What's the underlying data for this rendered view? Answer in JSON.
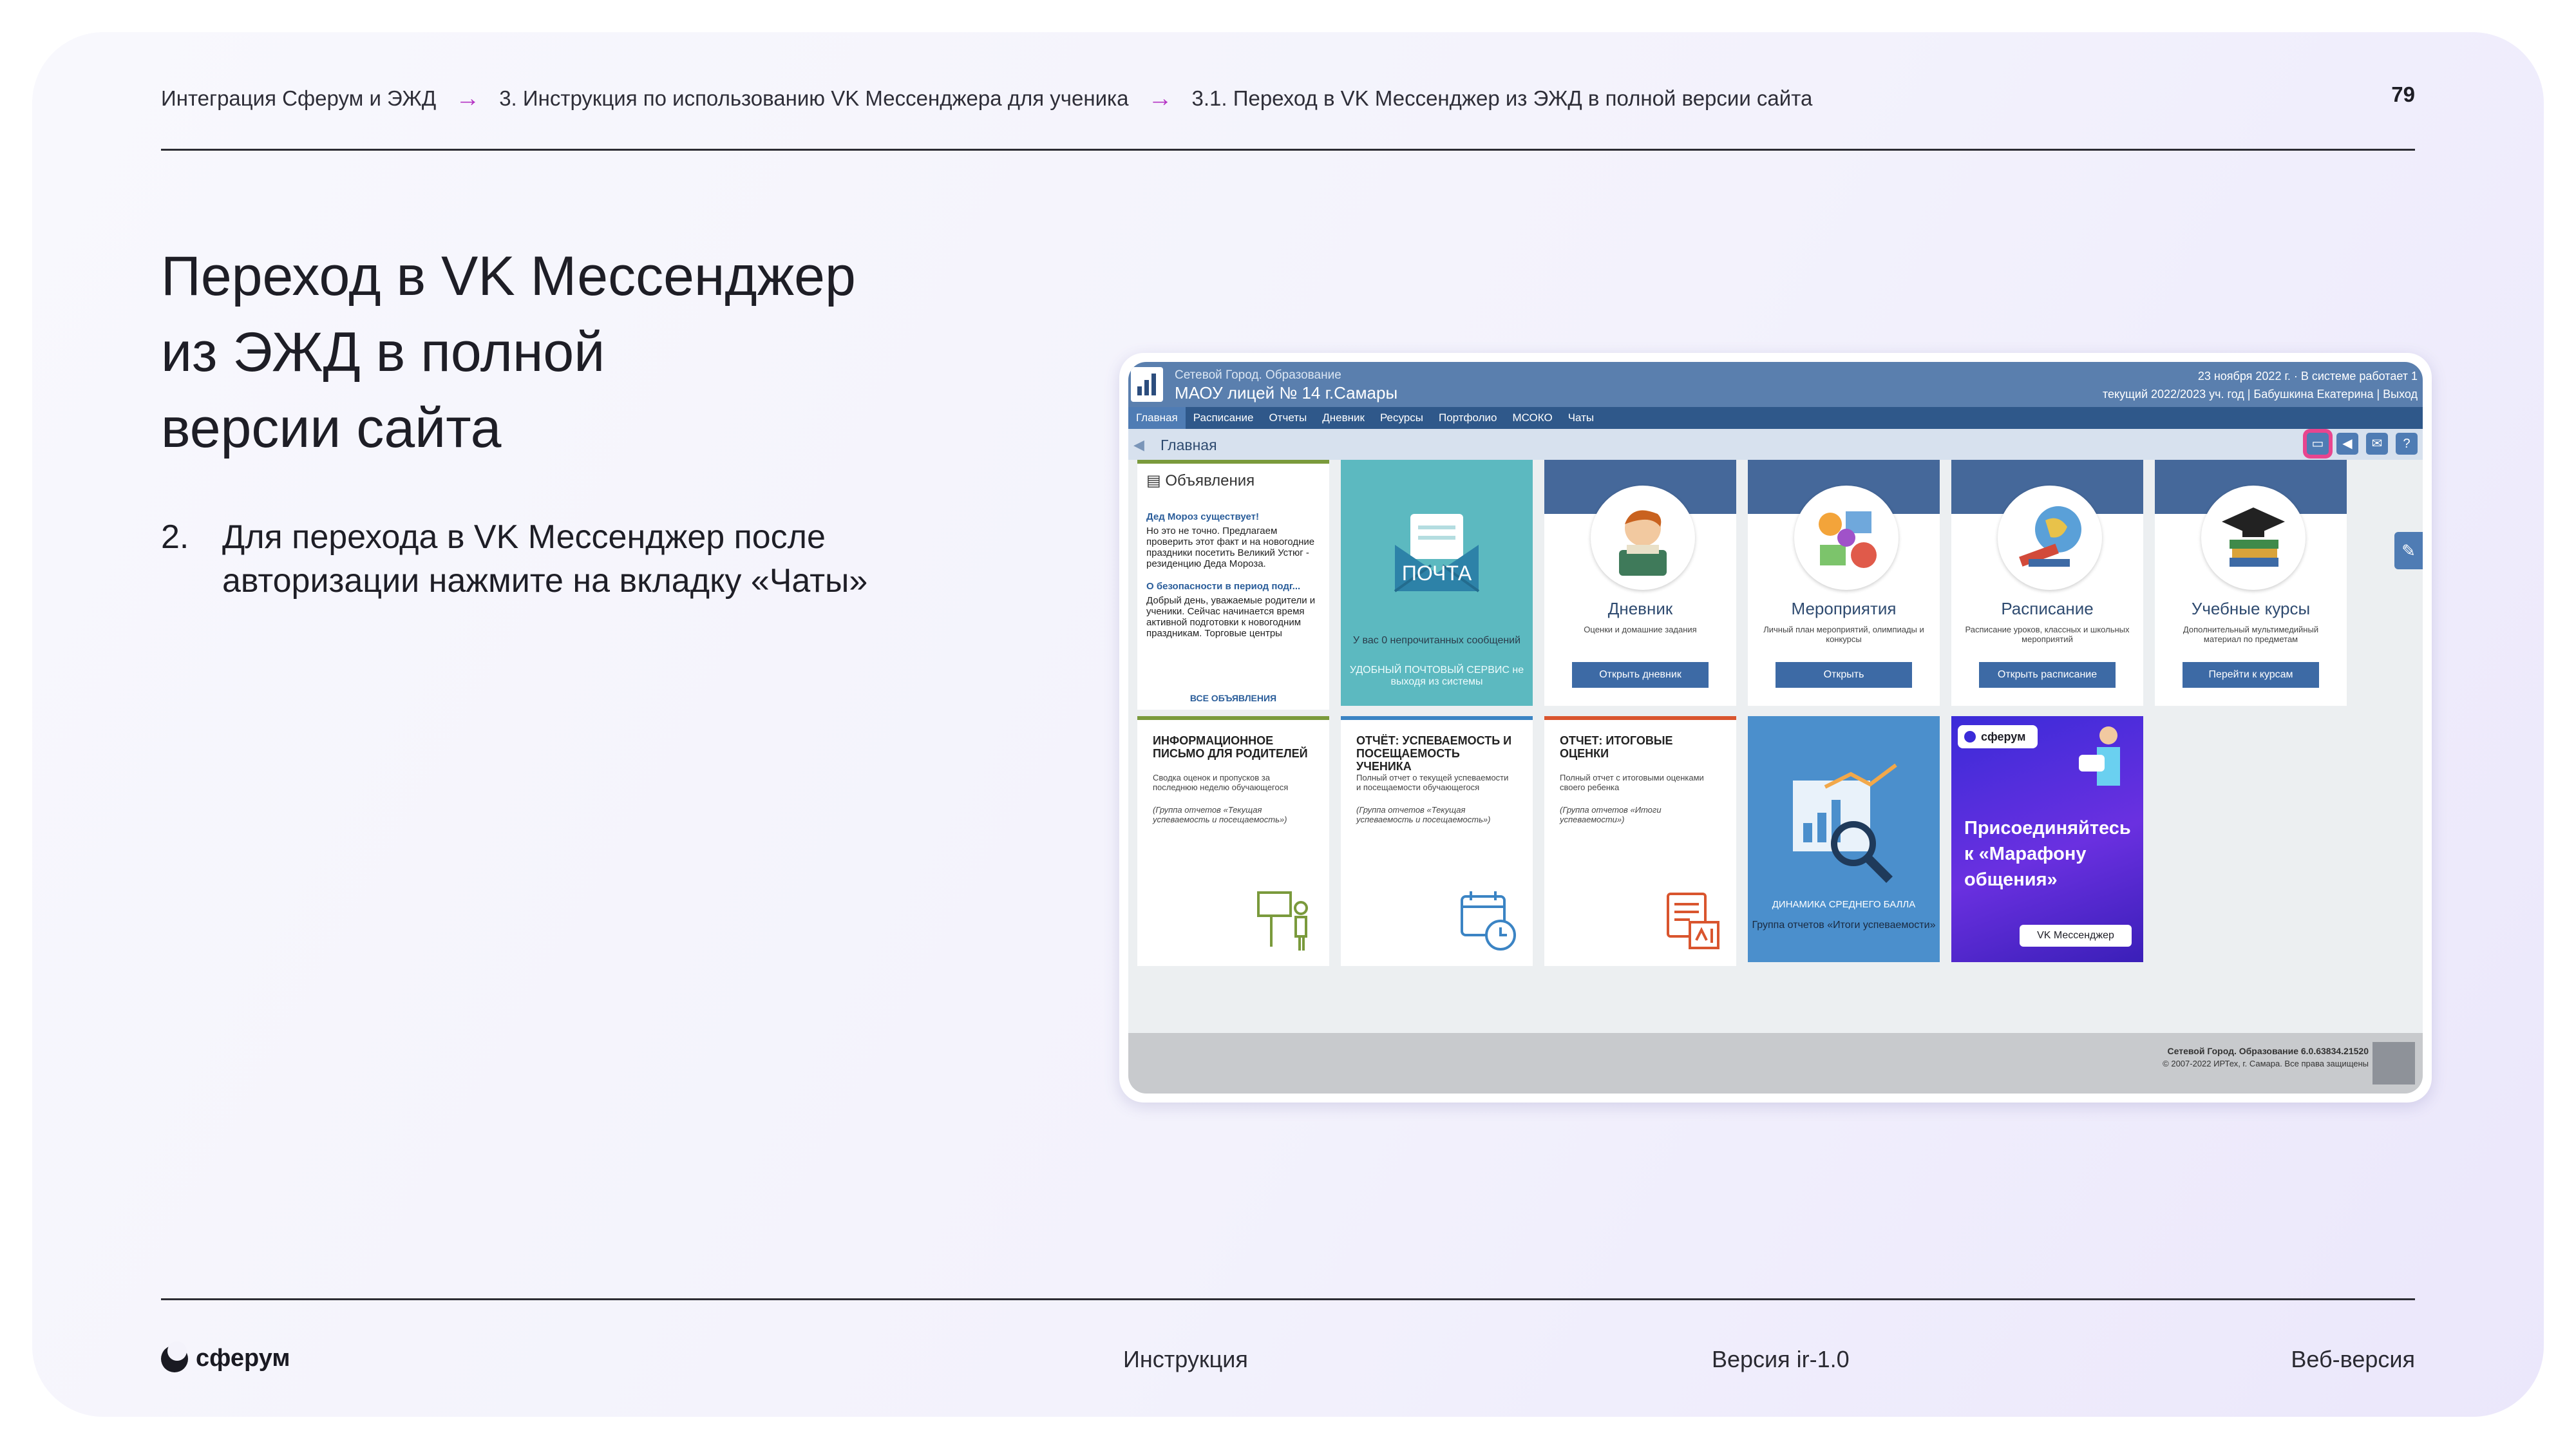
{
  "breadcrumb": {
    "items": [
      "Интеграция Сферум и ЭЖД",
      "3. Инструкция по использованию VK Мессенджера для ученика",
      "3.1. Переход в VK Мессенджер из ЭЖД в полной версии сайта"
    ],
    "separator": "→"
  },
  "page_number": "79",
  "title_lines": [
    "Переход в VK Мессенджер",
    "из ЭЖД в полной",
    "версии сайта"
  ],
  "step": {
    "number": "2.",
    "lines": [
      "Для перехода в VK Мессенджер после",
      "авторизации нажмите на вкладку «Чаты»"
    ]
  },
  "screenshot": {
    "header": {
      "system": "Сетевой Город. Образование",
      "school": "МАОУ лицей № 14 г.Самары",
      "date": "23 ноября 2022 г. · В системе работает 1",
      "year_user": "текущий 2022/2023 уч. год | Бабушкина Екатерина | Выход"
    },
    "menu": [
      "Главная",
      "Расписание",
      "Отчеты",
      "Дневник",
      "Ресурсы",
      "Портфолио",
      "МСОКО",
      "Чаты"
    ],
    "crumb": "Главная",
    "announcements": {
      "title": "Объявления",
      "link1": "Дед Мороз существует!",
      "text1": "Но это не точно. Предлагаем проверить этот факт и на новогодние праздники посетить Великий Устюг - резиденцию Деда Мороза.",
      "link2": "О безопасности в период подг...",
      "text2": "Добрый день, уважаемые родители и ученики. Сейчас начинается время активной подготовки к новогодним праздникам. Торговые центры",
      "all": "ВСЕ ОБЪЯВЛЕНИЯ"
    },
    "mail": {
      "word": "ПОЧТА",
      "count": "У вас 0 непрочитанных сообщений",
      "service": "УДОБНЫЙ ПОЧТОВЫЙ СЕРВИС не выходя из системы"
    },
    "features": [
      {
        "title": "Дневник",
        "desc": "Оценки и домашние задания",
        "button": "Открыть дневник"
      },
      {
        "title": "Мероприятия",
        "desc": "Личный план мероприятий, олимпиады и конкурсы",
        "button": "Открыть"
      },
      {
        "title": "Расписание",
        "desc": "Расписание уроков, классных и школьных мероприятий",
        "button": "Открыть расписание"
      },
      {
        "title": "Учебные курсы",
        "desc": "Дополнительный мультимедийный материал по предметам",
        "button": "Перейти к курсам"
      }
    ],
    "reports": [
      {
        "title": "ИНФОРМАЦИОННОЕ ПИСЬМО ДЛЯ РОДИТЕЛЕЙ",
        "desc": "Сводка оценок и пропусков за последнюю неделю обучающегося",
        "group": "(Группа отчетов «Текущая успеваемость и посещаемость»)",
        "color": "#7a9a3c"
      },
      {
        "title": "ОТЧЁТ: УСПЕВАЕМОСТЬ И ПОСЕЩАЕМОСТЬ УЧЕНИКА",
        "desc": "Полный отчет о текущей успеваемости и посещаемости обучающегося",
        "group": "(Группа отчетов «Текущая успеваемость и посещаемость»)",
        "color": "#3b84c4"
      },
      {
        "title": "ОТЧЕТ: ИТОГОВЫЕ ОЦЕНКИ",
        "desc": "Полный отчет с итоговыми оценками своего ребенка",
        "group": "(Группа отчетов «Итоги успеваемости»)",
        "color": "#d9552e"
      }
    ],
    "dynamics": {
      "title": "ДИНАМИКА СРЕДНЕГО БАЛЛА",
      "group": "Группа отчетов «Итоги успеваемости»"
    },
    "promo": {
      "badge": "сферум",
      "title": "Присоединяйтесь к «Марафону общения»",
      "button": "VK Мессенджер"
    },
    "footer": {
      "line1": "Сетевой Город. Образование 6.0.63834.21520",
      "line2": "© 2007-2022 ИРТех, г. Самара. Все права защищены"
    }
  },
  "footer": {
    "logo": "сферум",
    "doc_type": "Инструкция",
    "version": "Версия ir-1.0",
    "edition": "Веб-версия"
  }
}
